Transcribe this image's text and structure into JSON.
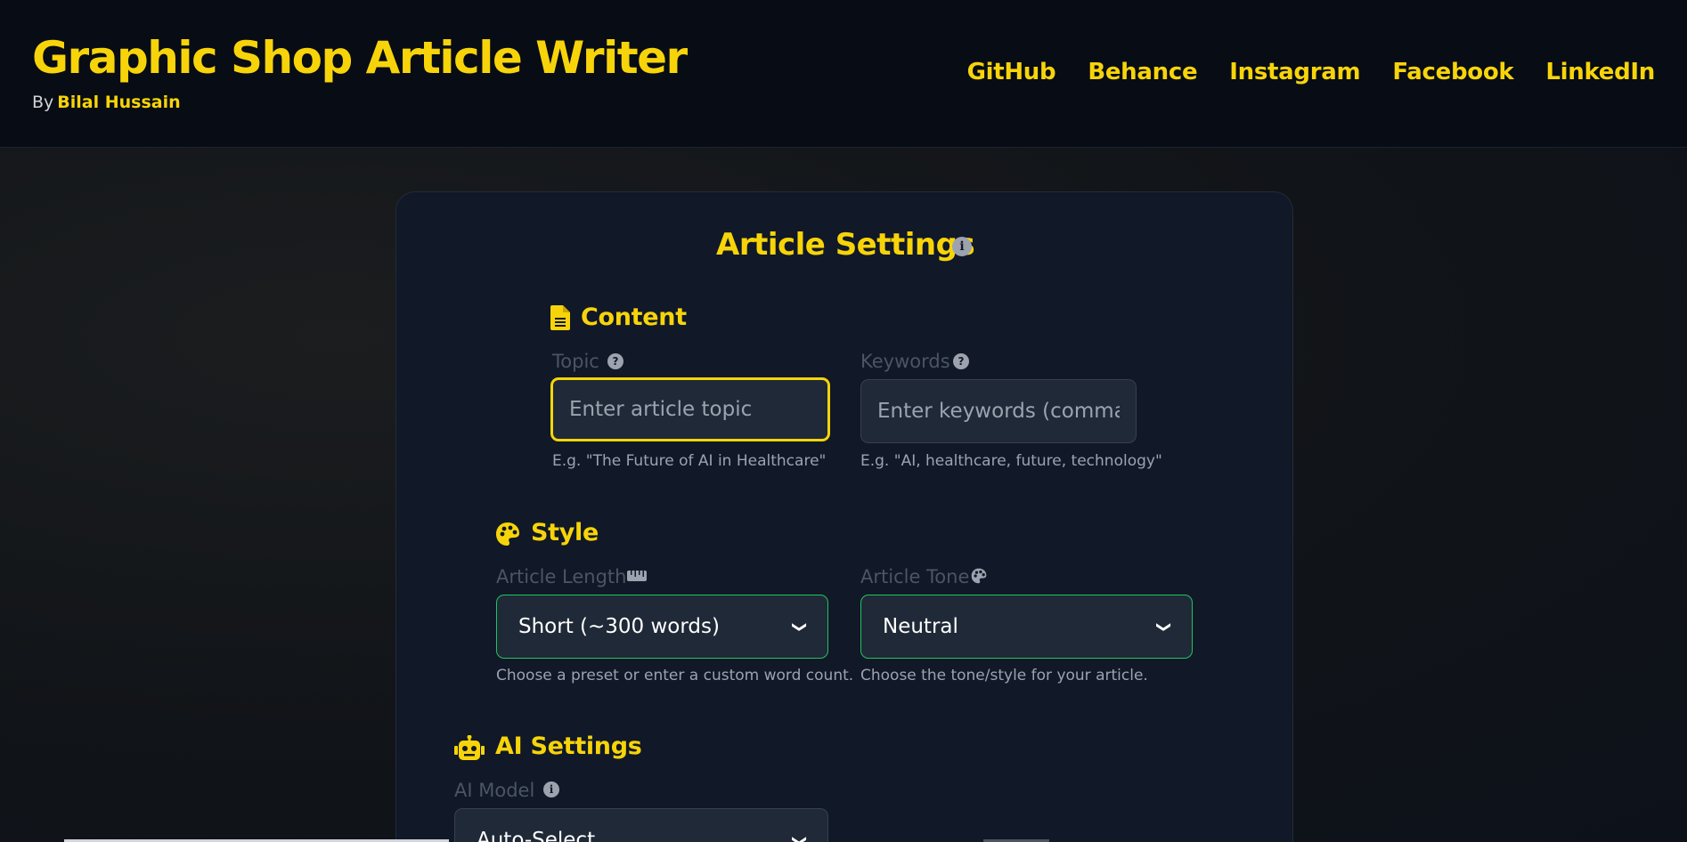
{
  "header": {
    "title": "Graphic Shop Article Writer",
    "by": "By",
    "author": "Bilal Hussain",
    "nav": [
      "GitHub",
      "Behance",
      "Instagram",
      "Facebook",
      "LinkedIn"
    ]
  },
  "panel": {
    "title": "Article Settings",
    "info_glyph": "i"
  },
  "content": {
    "title": "Content",
    "topic": {
      "label": "Topic",
      "placeholder": "Enter article topic",
      "hint": "E.g. \"The Future of AI in Healthcare\""
    },
    "keywords": {
      "label": "Keywords",
      "placeholder": "Enter keywords (comma-s",
      "hint": "E.g. \"AI, healthcare, future, technology\""
    }
  },
  "style": {
    "title": "Style",
    "length": {
      "label": "Article Length",
      "value": "Short (~300 words)",
      "hint": "Choose a preset or enter a custom word count."
    },
    "tone": {
      "label": "Article Tone",
      "value": "Neutral",
      "hint": "Choose the tone/style for your article."
    }
  },
  "ai": {
    "title": "AI Settings",
    "model": {
      "label": "AI Model",
      "value": "Auto-Select"
    }
  },
  "icons": {
    "help": "question-icon",
    "info": "info-icon",
    "document": "document-icon",
    "palette": "palette-icon",
    "ruler": "ruler-icon",
    "robot": "robot-icon",
    "chevron": "chevron-down-icon"
  },
  "colors": {
    "accent": "#f7d40a",
    "valid_border": "#22c55e",
    "background": "#111827"
  }
}
